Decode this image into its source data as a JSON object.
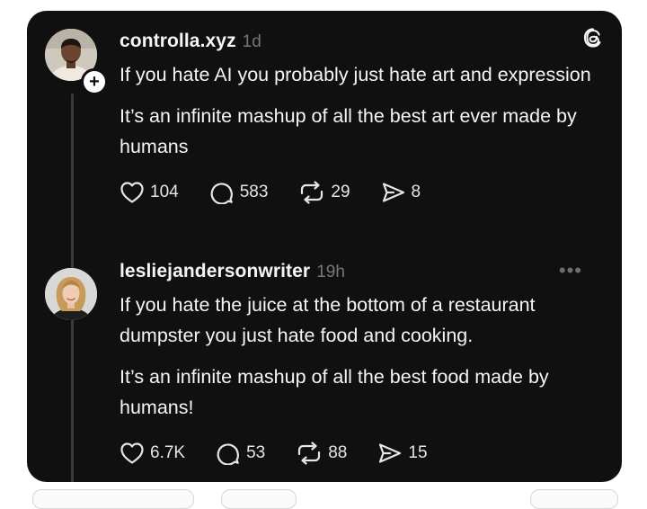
{
  "posts": [
    {
      "username": "controlla.xyz",
      "time": "1d",
      "paragraphs": [
        "If you hate AI you probably just hate art and expression",
        "It’s an infinite mashup of all the best art ever made by humans"
      ],
      "stats": {
        "likes": "104",
        "replies": "583",
        "reposts": "29",
        "shares": "8"
      }
    },
    {
      "username": "lesliejandersonwriter",
      "time": "19h",
      "more": "•••",
      "paragraphs": [
        "If you hate the juice at the bottom of a restaurant dumpster you just hate food and cooking.",
        "It’s an infinite mashup of all the best food made by humans!"
      ],
      "stats": {
        "likes": "6.7K",
        "replies": "53",
        "reposts": "88",
        "shares": "15"
      }
    }
  ],
  "icons": {
    "app": "threads-logo-icon",
    "like": "heart-icon",
    "reply": "comment-icon",
    "repost": "repost-icon",
    "share": "send-icon",
    "follow": "plus-icon"
  },
  "colors": {
    "card": "#101010",
    "text": "#f3f5f7",
    "muted": "#777777",
    "line": "#3a3a3a"
  },
  "follow_badge": "+"
}
